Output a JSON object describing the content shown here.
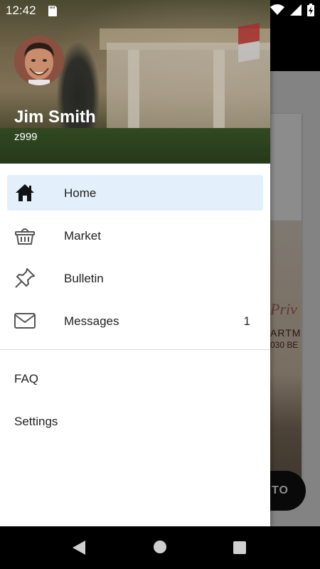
{
  "status_bar": {
    "time": "12:42"
  },
  "drawer": {
    "user_name": "Jim Smith",
    "user_id": "z999",
    "nav_items": [
      {
        "label": "Home",
        "icon": "home-icon",
        "selected": true
      },
      {
        "label": "Market",
        "icon": "basket-icon"
      },
      {
        "label": "Bulletin",
        "icon": "pushpin-icon"
      },
      {
        "label": "Messages",
        "icon": "mail-icon",
        "count": "1"
      }
    ],
    "secondary_items": [
      {
        "label": "FAQ"
      },
      {
        "label": "Settings"
      }
    ]
  },
  "background": {
    "sign_text": "Priv",
    "sign_line1": "ARTM",
    "sign_line2": "030 BE",
    "fab_label": "TO"
  },
  "colors": {
    "selected_bg": "#e3f0fc",
    "text": "#222222",
    "scrim": "rgba(0,0,0,0.45)"
  }
}
